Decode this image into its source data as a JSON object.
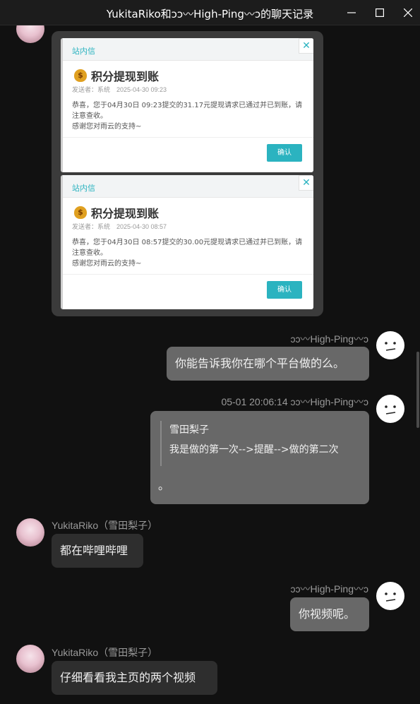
{
  "window": {
    "title": "YukitaRiko和ↄↄ〰High-Ping〰ↄ的聊天记录",
    "minimize_glyph": "—",
    "maximize_glyph": "☐",
    "close_glyph": "✕"
  },
  "contacts": {
    "left_name": "YukitaRiko（雪田梨子）",
    "right_name": "ↄↄ〰High-Ping〰ↄ"
  },
  "image_message": {
    "notices": [
      {
        "tag": "站内信",
        "title": "积分提现到账",
        "meta": "发送者：系统　2025-04-30 09:23",
        "body_line1": "恭喜，您于04月30日 09:23提交的31.17元提现请求已通过并已到账，请注意查收。",
        "body_line2": "感谢您对雨云的支持~",
        "confirm": "确认"
      },
      {
        "tag": "站内信",
        "title": "积分提现到账",
        "meta": "发送者：系统　2025-04-30 08:57",
        "body_line1": "恭喜，您于04月30日 08:57提交的30.00元提现请求已通过并已到账，请注意查收。",
        "body_line2": "感谢您对雨云的支持~",
        "confirm": "确认"
      }
    ]
  },
  "messages": {
    "m1": {
      "sender": "ↄↄ〰High-Ping〰ↄ",
      "text": "你能告诉我你在哪个平台做的么。"
    },
    "m2": {
      "sender": "05-01 20:06:14 ↄↄ〰High-Ping〰ↄ",
      "quote_author": "雪田梨子",
      "quote_text": "我是做的第一次-->提醒-->做的第二次",
      "text": "。"
    },
    "m3": {
      "sender": "YukitaRiko（雪田梨子）",
      "text": "都在哔哩哔哩"
    },
    "m4": {
      "sender": "ↄↄ〰High-Ping〰ↄ",
      "text": "你视频呢。"
    },
    "m5": {
      "sender": "YukitaRiko（雪田梨子）",
      "text": "仔细看看我主页的两个视频"
    }
  },
  "colors": {
    "background": "#111111",
    "bubble_left": "#2e2e2e",
    "bubble_right": "#686868",
    "accent": "#2bb3c0"
  }
}
